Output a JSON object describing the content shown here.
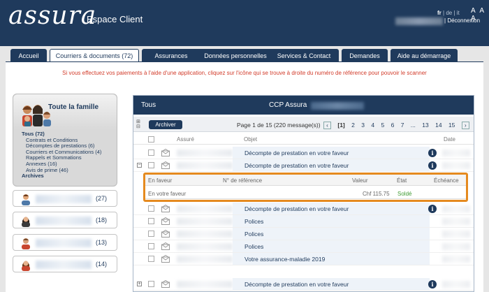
{
  "header": {
    "logo": "assura",
    "title": "Espace Client",
    "languages": [
      {
        "label": "fr",
        "active": true
      },
      {
        "label": "de",
        "active": false
      },
      {
        "label": "it",
        "active": false
      }
    ],
    "font_sizes": "A A A",
    "logout_label": "Déconnexion"
  },
  "tabs": [
    {
      "label": "Accueil",
      "active": false
    },
    {
      "label": "Courriers & documents (72)",
      "active": true
    },
    {
      "label": "Assurances",
      "active": false
    },
    {
      "label": "Données personnelles",
      "active": false
    },
    {
      "label": "Services & Contact",
      "active": false
    },
    {
      "label": "Demandes",
      "active": false
    },
    {
      "label": "Aide au démarrage",
      "active": false
    }
  ],
  "notice": "Si vous effectuez vos paiements à l'aide d'une application, cliquez sur l'icône qui se trouve à droite du numéro de référence pour pouvoir le scanner",
  "family": {
    "title": "Toute la famille",
    "menu": [
      {
        "label": "Tous (72)",
        "level": 1
      },
      {
        "label": "Contrats et Conditions",
        "level": 2
      },
      {
        "label": "Décomptes de prestations (6)",
        "level": 2
      },
      {
        "label": "Courriers et Communications (4)",
        "level": 2
      },
      {
        "label": "Rappels et Sommations",
        "level": 2
      },
      {
        "label": "Annexes (16)",
        "level": 2
      },
      {
        "label": "Avis de prime (46)",
        "level": 2
      },
      {
        "label": "Archives",
        "level": 1
      }
    ],
    "members": [
      {
        "count": "(27)",
        "gender": "male"
      },
      {
        "count": "(18)",
        "gender": "female"
      },
      {
        "count": "(13)",
        "gender": "male"
      },
      {
        "count": "(14)",
        "gender": "female"
      }
    ]
  },
  "panel": {
    "filter": "Tous",
    "title": "CCP Assura",
    "archive_button": "Archiver",
    "page_info": "Page 1 de 15 (220 message(s))",
    "pages": [
      "[1]",
      "2",
      "3",
      "4",
      "5",
      "6",
      "7",
      "...",
      "13",
      "14",
      "15"
    ],
    "columns": {
      "insured": "Assuré",
      "subject": "Objet",
      "date": "Date"
    },
    "rows": [
      {
        "subject": "Décompte de prestation en votre faveur",
        "info": true,
        "expand": ""
      },
      {
        "subject": "Décompte de prestation en votre faveur",
        "info": true,
        "expand": "−"
      },
      {
        "subject": "Décompte de prestation en votre faveur",
        "info": true,
        "expand": ""
      },
      {
        "subject": "Polices",
        "info": false,
        "expand": ""
      },
      {
        "subject": "Polices",
        "info": false,
        "expand": ""
      },
      {
        "subject": "Polices",
        "info": false,
        "expand": ""
      },
      {
        "subject": "Votre assurance-maladie 2019",
        "info": false,
        "expand": ""
      },
      {
        "subject": "Décompte de prestation en votre faveur",
        "info": true,
        "expand": "+"
      }
    ],
    "detail": {
      "headers": {
        "favor": "En faveur",
        "ref": "N° de référence",
        "value": "Valeur",
        "state": "État",
        "due": "Échéance"
      },
      "values": {
        "favor": "En votre faveur",
        "ref": "",
        "value": "Chf 115.75",
        "state": "Soldé",
        "due": ""
      }
    }
  },
  "colors": {
    "brand_navy": "#1f3a5c",
    "notice_red": "#d23b2a",
    "highlight_orange": "#e58a1f",
    "paid_green": "#3f9b33"
  }
}
